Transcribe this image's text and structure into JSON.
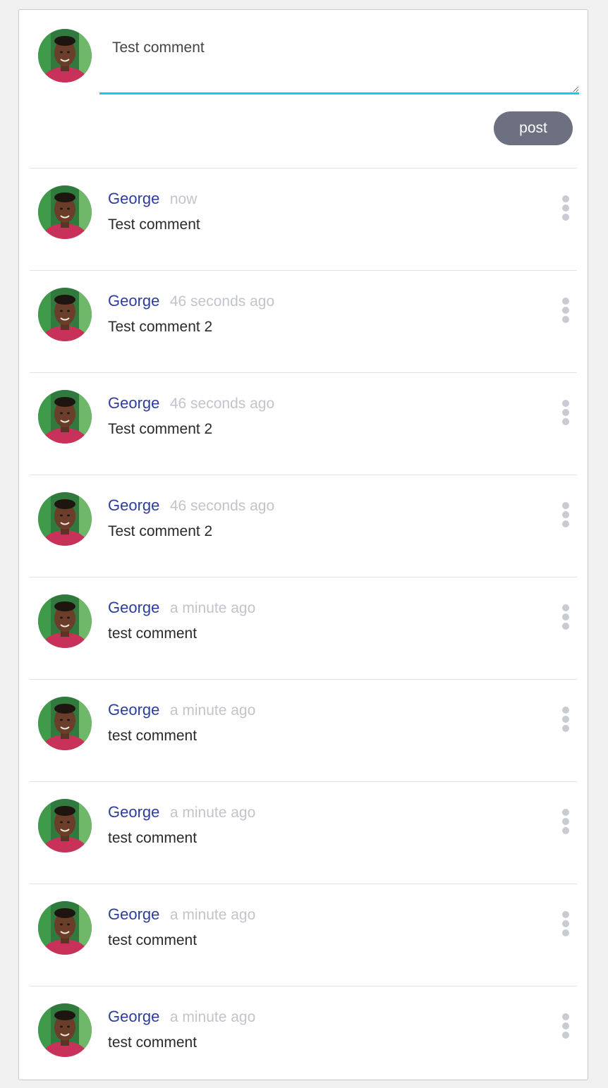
{
  "composer": {
    "input_value": "Test comment",
    "post_label": "post"
  },
  "colors": {
    "accent": "#22c4ee",
    "author": "#2c3d9c",
    "post_button": "#6d7080",
    "timestamp": "#c2c4cc"
  },
  "comments": [
    {
      "author": "George",
      "time": "now",
      "text": "Test comment"
    },
    {
      "author": "George",
      "time": "46 seconds ago",
      "text": "Test comment 2"
    },
    {
      "author": "George",
      "time": "46 seconds ago",
      "text": "Test comment 2"
    },
    {
      "author": "George",
      "time": "46 seconds ago",
      "text": "Test comment 2"
    },
    {
      "author": "George",
      "time": "a minute ago",
      "text": "test comment"
    },
    {
      "author": "George",
      "time": "a minute ago",
      "text": "test comment"
    },
    {
      "author": "George",
      "time": "a minute ago",
      "text": "test comment"
    },
    {
      "author": "George",
      "time": "a minute ago",
      "text": "test comment"
    },
    {
      "author": "George",
      "time": "a minute ago",
      "text": "test comment"
    }
  ],
  "icons": {
    "avatar": "user-avatar-photo",
    "more": "more-vertical-icon"
  }
}
